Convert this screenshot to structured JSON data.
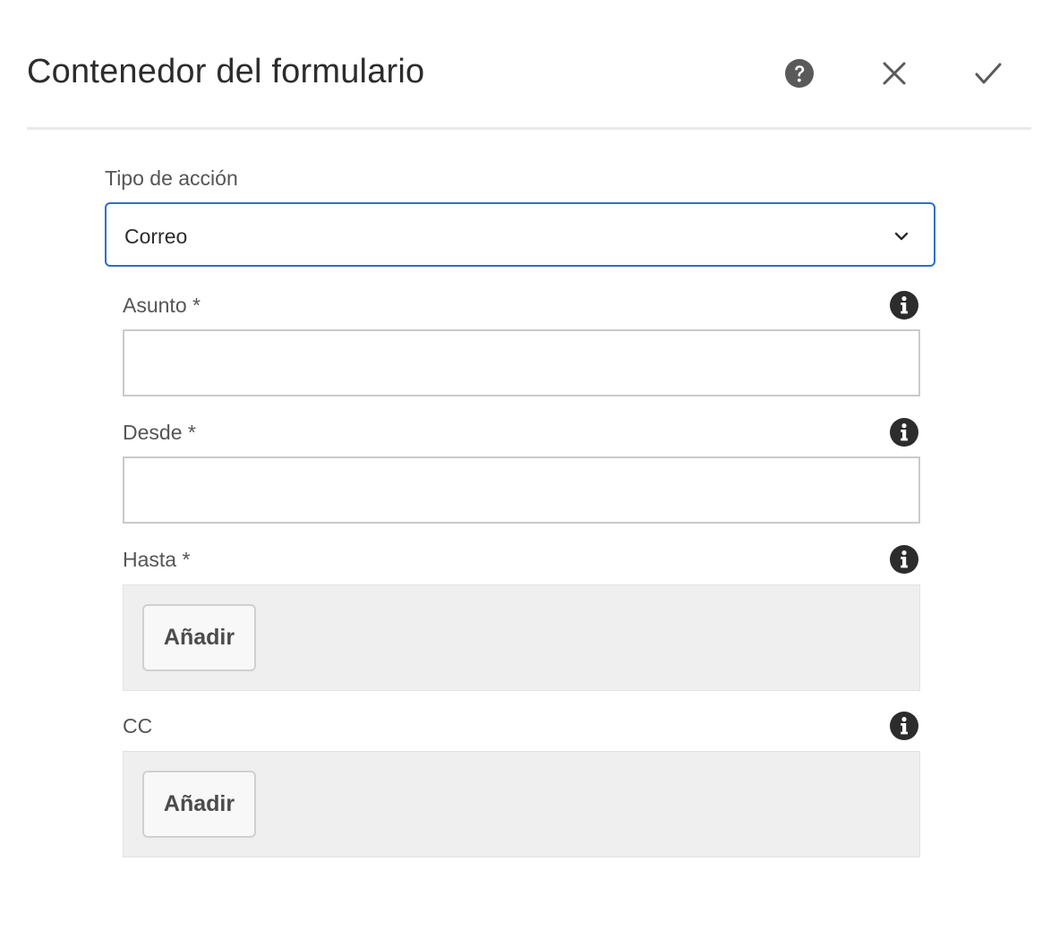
{
  "dialog": {
    "title": "Contenedor del formulario",
    "icons": {
      "help": "help-circle-icon",
      "close": "close-icon",
      "done": "checkmark-icon"
    }
  },
  "form": {
    "action_type": {
      "label": "Tipo de acción",
      "selected_value": "Correo",
      "icon": "chevron-down-icon"
    },
    "subject": {
      "label": "Asunto *",
      "value": "",
      "icon": "info-icon"
    },
    "from": {
      "label": "Desde *",
      "value": "",
      "icon": "info-icon"
    },
    "to": {
      "label": "Hasta *",
      "add_label": "Añadir",
      "icon": "info-icon"
    },
    "cc": {
      "label": "CC",
      "add_label": "Añadir",
      "icon": "info-icon"
    }
  },
  "colors": {
    "focus_border": "#2f6fc8",
    "icon_dark": "#2c2c2c",
    "multifield_bg": "#efefef"
  }
}
